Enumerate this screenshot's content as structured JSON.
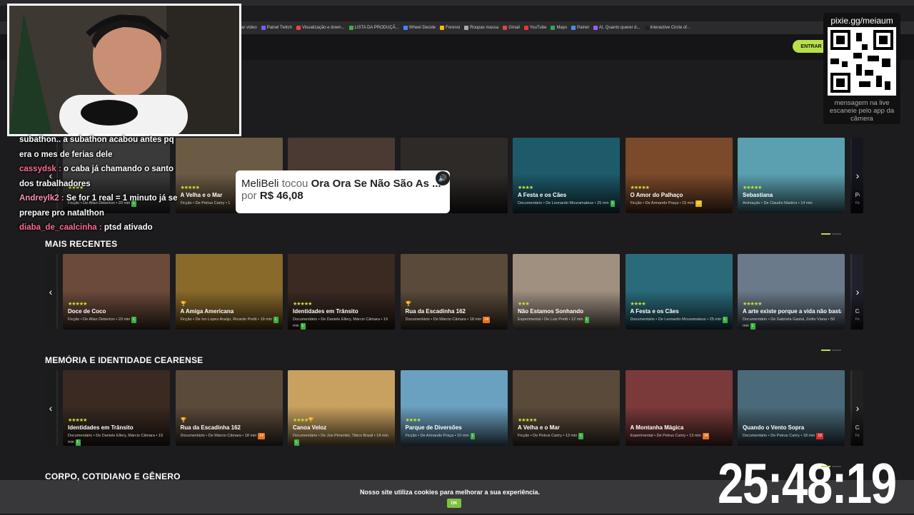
{
  "browser": {
    "bookmarks": [
      "ar vídeo",
      "Painel Twitch",
      "Visualização e down...",
      "LISTA DA PRODUÇÃ...",
      "Wheel Decide",
      "Forensi",
      "Roupas massa",
      "Gmail",
      "YouTube",
      "Maps",
      "Painel",
      "AI, Quanto querer d...",
      "Interactive Circle of..."
    ]
  },
  "site": {
    "login_label": "ENTRAR",
    "sections": [
      {
        "title": "",
        "cards": [
          {
            "stars": "★★★★",
            "title": "",
            "meta": "Ficção • De Allan Deberton • 20 min",
            "badge": "L"
          },
          {
            "stars": "★★★★★",
            "title": "A Velha e o Mar",
            "meta": "Ficção • De Petrus Cariry • 1",
            "badge": ""
          },
          {
            "stars": "",
            "title": "",
            "meta": "",
            "badge": ""
          },
          {
            "stars": "",
            "title": "",
            "meta": "as Cariry • 10 min",
            "badge": "14"
          },
          {
            "stars": "★★★★",
            "title": "A Festa e os Cães",
            "meta": "Documentário • De Leonardo Mouramateus • 25 min",
            "badge": "L"
          },
          {
            "stars": "★★★★★",
            "title": "O Amor do Palhaço",
            "meta": "Ficção • De Armando Praça • 15 min",
            "badge": "12"
          },
          {
            "stars": "★★★★★",
            "title": "Sebastiana",
            "meta": "Animação • De Claudio Martins • 14 min",
            "badge": ""
          },
          {
            "stars": "",
            "title": "Pe",
            "meta": "Ficç",
            "badge": ""
          }
        ]
      },
      {
        "title": "MAIS RECENTES",
        "cards": [
          {
            "stars": "★★★★★",
            "title": "Doce de Coco",
            "meta": "Ficção • De Allan Deberton • 20 min",
            "badge": "L"
          },
          {
            "stars": "🏆",
            "title": "A Amiga Americana",
            "meta": "Ficção • De Ivo Lopes Araújo, Ricardo Pretti • 19 min",
            "badge": "L"
          },
          {
            "stars": "★★★★★",
            "title": "Identidades em Trânsito",
            "meta": "Documentário • De Daniele Ellery, Márcio Câmara • 19 min",
            "badge": "L"
          },
          {
            "stars": "🏆",
            "title": "Rua da Escadinha 162",
            "meta": "Documentário • De Márcio Câmara • 18 min",
            "badge": "14"
          },
          {
            "stars": "★★★",
            "title": "Não Estamos Sonhando",
            "meta": "Experimental • De Luiz Pretti • 12 min",
            "badge": "L"
          },
          {
            "stars": "★★★★",
            "title": "A Festa e os Cães",
            "meta": "Documentário • De Leonardo Mouramateus • 25 min",
            "badge": "L"
          },
          {
            "stars": "★★★★★",
            "title": "A arte existe porque a vida não basta",
            "meta": "Documentário • De Gabriela Gastal, Zelito Viana • 50 min",
            "badge": "L"
          },
          {
            "stars": "",
            "title": "Ca",
            "meta": "Ficç",
            "badge": ""
          }
        ]
      },
      {
        "title": "MEMÓRIA E IDENTIDADE CEARENSE",
        "cards": [
          {
            "stars": "★★★★★",
            "title": "Identidades em Trânsito",
            "meta": "Documentário • De Daniele Ellery, Márcio Câmara • 19 min",
            "badge": "L"
          },
          {
            "stars": "🏆",
            "title": "Rua da Escadinha 162",
            "meta": "Documentário • De Márcio Câmara • 18 min",
            "badge": "14"
          },
          {
            "stars": "★★★★🏆",
            "title": "Canoa Veloz",
            "meta": "Documentário • De Joe Pimentel, Tibico Brasil • 14 min",
            "badge": "L"
          },
          {
            "stars": "★★★★",
            "title": "Parque de Diversões",
            "meta": "Ficção • De Armando Praça • 10 min",
            "badge": "L"
          },
          {
            "stars": "★★★★★",
            "title": "A Velha e o Mar",
            "meta": "Ficção • De Petrus Cariry • 13 min",
            "badge": "L"
          },
          {
            "stars": "",
            "title": "A Montanha Mágica",
            "meta": "Experimental • De Petrus Cariry • 13 min",
            "badge": "14"
          },
          {
            "stars": "",
            "title": "Quando o Vento Sopra",
            "meta": "Documentário • De Petrus Cariry • 18 min",
            "badge": "18"
          },
          {
            "stars": "",
            "title": "Ca",
            "meta": "Ficç",
            "badge": ""
          }
        ]
      },
      {
        "title": "CORPO, COTIDIANO E GÊNERO",
        "cards": []
      }
    ],
    "cookie_text": "Nosso site utiliza cookies para melhorar a sua experiência.",
    "cookie_ok": "OK"
  },
  "stream": {
    "chat": [
      {
        "user": "",
        "text": "subathon.. a subathon acabou antes pq era o mes de ferias dele"
      },
      {
        "user": "cassydsk :",
        "text": " o caba já chamando o santo dos trabalhadores"
      },
      {
        "user": "Andreylk2 :",
        "text": " Se for 1 real = 1 minuto já se prepare pro natalthon"
      },
      {
        "user": "diaba_de_caalcinha :",
        "text": " ptsd ativado"
      }
    ],
    "alert": {
      "user": "MeliBeli",
      "action": "tocou",
      "song": "Ora Ora Se Não São As ...",
      "by": "por",
      "amount": "R$ 46,08"
    },
    "qr": {
      "url": "pixie.gg/meiaum",
      "message": "mensagem na live escaneie pelo app da câmera"
    },
    "timer": "25:48:19"
  },
  "colors": {
    "accent": "#b8e04a",
    "chat_user": "#ff6b8f",
    "badge_l": "#3cb043",
    "badge_14": "#e8731c",
    "badge_12": "#e2b714",
    "badge_18": "#d32f2f"
  }
}
